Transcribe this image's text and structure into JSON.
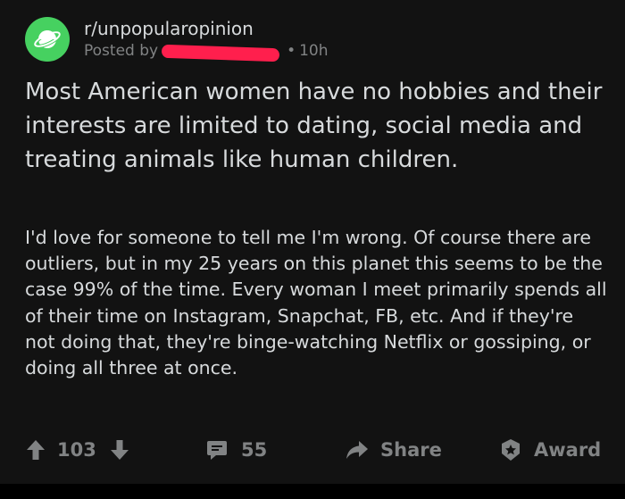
{
  "post": {
    "subreddit": "r/unpopularopinion",
    "posted_by_prefix": "Posted by",
    "age": "10h",
    "title": "Most American women have no hobbies and their interests are limited to dating, social media and treating animals like human children.",
    "body": "I'd love for someone to tell me I'm wrong. Of course there are outliers, but in my 25 years on this planet this seems to be the case 99% of the time. Every woman I meet primarily spends all of their time on Instagram, Snapchat, FB, etc. And if they're not doing that, they're binge-watching Netflix or gossiping, or doing all three at once."
  },
  "actions": {
    "vote_count": "103",
    "comment_count": "55",
    "share_label": "Share",
    "award_label": "Award"
  },
  "icons": {
    "subreddit": "planet-icon",
    "upvote": "arrow-up-icon",
    "downvote": "arrow-down-icon",
    "comment": "comment-bubble-icon",
    "share": "share-arrow-icon",
    "award": "award-star-icon"
  },
  "colors": {
    "background": "#121212",
    "text": "#d7dadc",
    "muted": "#818384",
    "subreddit_icon": "#46d160",
    "redaction": "#ff1f4d"
  }
}
